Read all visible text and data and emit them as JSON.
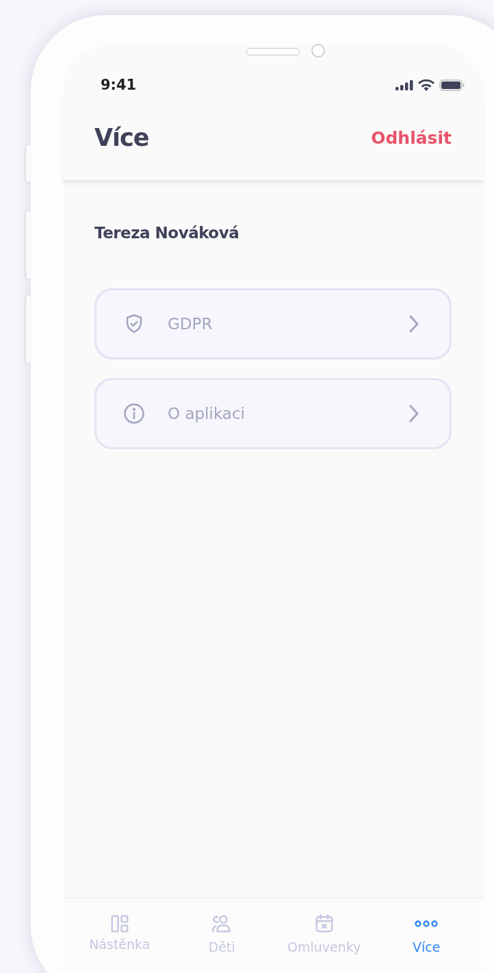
{
  "status_bar": {
    "time": "9:41"
  },
  "header": {
    "title": "Více",
    "action": "Odhlásit"
  },
  "user": {
    "name": "Tereza Nováková"
  },
  "menu": [
    {
      "kind": "gdpr",
      "label": "GDPR"
    },
    {
      "kind": "info",
      "label": "O aplikaci"
    }
  ],
  "tab_bar": [
    {
      "kind": "dashboard",
      "label": "Nástěnka",
      "selected": false
    },
    {
      "kind": "children",
      "label": "Děti",
      "selected": false
    },
    {
      "kind": "excuses",
      "label": "Omluvenky",
      "selected": false
    },
    {
      "kind": "more",
      "label": "Více",
      "selected": true
    }
  ]
}
